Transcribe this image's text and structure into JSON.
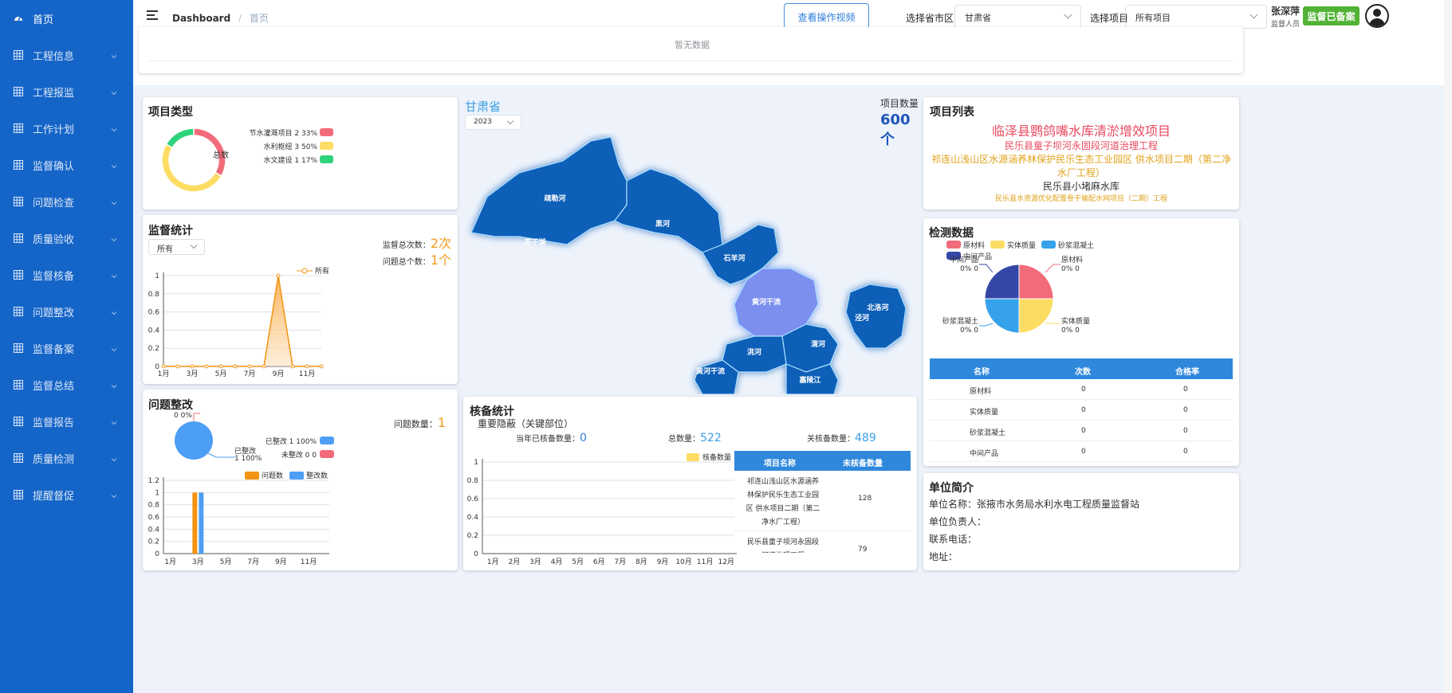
{
  "sidebar": {
    "items": [
      {
        "label": "首页",
        "icon": "dashboard-icon",
        "active": true
      },
      {
        "label": "工程信息",
        "icon": "grid-icon"
      },
      {
        "label": "工程报监",
        "icon": "grid-icon"
      },
      {
        "label": "工作计划",
        "icon": "grid-icon"
      },
      {
        "label": "监督确认",
        "icon": "grid-icon"
      },
      {
        "label": "问题检查",
        "icon": "grid-icon"
      },
      {
        "label": "质量验收",
        "icon": "grid-icon"
      },
      {
        "label": "监督核备",
        "icon": "grid-icon"
      },
      {
        "label": "问题整改",
        "icon": "grid-icon"
      },
      {
        "label": "监督备案",
        "icon": "grid-icon"
      },
      {
        "label": "监督总结",
        "icon": "grid-icon"
      },
      {
        "label": "监督报告",
        "icon": "grid-icon"
      },
      {
        "label": "质量检测",
        "icon": "grid-icon"
      },
      {
        "label": "提醒督促",
        "icon": "grid-icon"
      }
    ]
  },
  "header": {
    "breadcrumb_root": "Dashboard",
    "breadcrumb_sep": "/",
    "breadcrumb_current": "首页",
    "video_button": "查看操作视频",
    "city_label": "选择省市区",
    "city_value": "甘肃省",
    "project_label": "选择项目",
    "project_value": "所有项目",
    "user_name": "张深萍",
    "user_role": "监督人员",
    "status_button": "监督已备案"
  },
  "notice": {
    "empty_text": "暂无数据"
  },
  "project_type": {
    "title": "项目类型",
    "center_label": "总数",
    "legend": [
      {
        "name": "节水灌溉项目",
        "count": "2",
        "percent": "33%",
        "color": "#f26b7a",
        "value": 2
      },
      {
        "name": "水利枢纽",
        "count": "3",
        "percent": "50%",
        "color": "#fcdc62",
        "value": 3
      },
      {
        "name": "水文建设",
        "count": "1",
        "percent": "17%",
        "color": "#2fd37c",
        "value": 1
      }
    ]
  },
  "supervision": {
    "title": "监督统计",
    "filter_value": "所有",
    "total_label": "监督总次数：",
    "total_value": "2次",
    "problem_label": "问题总个数：",
    "problem_value": "1个",
    "legend": "所有"
  },
  "rectification": {
    "title": "问题整改",
    "count_label": "问题数量：",
    "count_value": "1",
    "pie_labels": {
      "top": "0  0%",
      "right_name": "已整改",
      "right_value": "1  100%"
    },
    "legend": [
      {
        "name": "已整改",
        "count": "1",
        "percent": "100%",
        "color": "#4d9ef5"
      },
      {
        "name": "未整改",
        "count": "0",
        "percent": "0",
        "color": "#f26b7a"
      }
    ],
    "bar_legend": [
      {
        "name": "问题数",
        "color": "#f39313"
      },
      {
        "name": "整改数",
        "color": "#4d9ef5"
      }
    ]
  },
  "map": {
    "province": "甘肃省",
    "year": "2023",
    "count_label": "项目数量",
    "count_value": "600个",
    "regions": [
      "疏勒河",
      "苏干湖",
      "黑河",
      "石羊河",
      "黄河干流",
      "北洛河",
      "泾河",
      "渭河",
      "洮河",
      "黄河干流",
      "嘉陵江"
    ]
  },
  "projects": {
    "title": "项目列表",
    "items": [
      {
        "text": "临泽县鹦鸽嘴水库清淤增效项目",
        "color": "#e84a5f",
        "size": 16
      },
      {
        "text": "民乐县童子坝河永固段河道治理工程",
        "color": "#e84a5f",
        "size": 12
      },
      {
        "text": "祁连山浅山区水源涵养林保护民乐生态工业园区 供水项目二期（第二净水厂工程）",
        "color": "#e0a21a",
        "size": 12
      },
      {
        "text": "民乐县小堵麻水库",
        "color": "#333333",
        "size": 12
      },
      {
        "text": "民乐县水资源优化配置骨干输配水网项目（二期）工程",
        "color": "#e0a21a",
        "size": 9
      }
    ]
  },
  "testing": {
    "title": "检测数据",
    "legend": [
      {
        "name": "原材料",
        "color": "#f26b7a"
      },
      {
        "name": "实体质量",
        "color": "#fcdc62"
      },
      {
        "name": "砂浆混凝土",
        "color": "#36a2eb"
      },
      {
        "name": "中间产品",
        "color": "#3447a6"
      }
    ],
    "pie_labels": [
      {
        "name": "原材料",
        "value": "0%  0"
      },
      {
        "name": "实体质量",
        "value": "0%  0"
      },
      {
        "name": "砂浆混凝土",
        "value": "0%  0"
      },
      {
        "name": "中间产品",
        "value": "0%  0"
      }
    ],
    "table_headers": [
      "名称",
      "次数",
      "合格率"
    ],
    "rows": [
      [
        "原材料",
        "0",
        "0"
      ],
      [
        "实体质量",
        "0",
        "0"
      ],
      [
        "砂浆混凝土",
        "0",
        "0"
      ],
      [
        "中间产品",
        "0",
        "0"
      ]
    ]
  },
  "verify": {
    "title": "核备统计",
    "subtitle": "重要隐蔽（关键部位）",
    "month_label": "当年已核备数量：",
    "month_value": "0",
    "total_label": "总数量：",
    "total_value": "522",
    "closed_label": "关核备数量：",
    "closed_value": "489",
    "legend": "核备数量",
    "table_headers": [
      "项目名称",
      "未核备数量"
    ],
    "rows": [
      {
        "name": "祁连山浅山区水源涵养林保护民乐生态工业园区 供水项目二期（第二净水厂工程）",
        "count": "128"
      },
      {
        "name": "民乐县童子坝河永固段河道治理工程",
        "count": "79"
      }
    ]
  },
  "unit": {
    "title": "单位简介",
    "name_label": "单位名称：",
    "name_value": "张掖市水务局水利水电工程质量监督站",
    "leader_label": "单位负责人：",
    "phone_label": "联系电话：",
    "address_label": "地址："
  },
  "chart_data": [
    {
      "type": "pie",
      "title": "项目类型",
      "labels": [
        "节水灌溉项目",
        "水利枢纽",
        "水文建设"
      ],
      "values": [
        2,
        3,
        1
      ]
    },
    {
      "type": "line",
      "title": "监督统计",
      "categories": [
        "1月",
        "2月",
        "3月",
        "4月",
        "5月",
        "6月",
        "7月",
        "8月",
        "9月",
        "10月",
        "11月",
        "12月"
      ],
      "tick_labels": [
        "1月",
        "3月",
        "5月",
        "7月",
        "9月",
        "11月"
      ],
      "series": [
        {
          "name": "所有",
          "values": [
            0,
            0,
            0,
            0,
            0,
            0,
            0,
            0,
            1,
            0,
            0,
            0
          ]
        }
      ],
      "ylim": [
        0,
        1
      ],
      "yticks": [
        "0",
        "0.2",
        "0.4",
        "0.6",
        "0.8",
        "1"
      ]
    },
    {
      "type": "bar",
      "title": "问题整改",
      "categories": [
        "1月",
        "2月",
        "3月",
        "4月",
        "5月",
        "6月",
        "7月",
        "8月",
        "9月",
        "10月",
        "11月",
        "12月"
      ],
      "tick_labels": [
        "1月",
        "3月",
        "5月",
        "7月",
        "9月",
        "11月"
      ],
      "series": [
        {
          "name": "问题数",
          "values": [
            0,
            0,
            1,
            0,
            0,
            0,
            0,
            0,
            0,
            0,
            0,
            0
          ]
        },
        {
          "name": "整改数",
          "values": [
            0,
            0,
            1,
            0,
            0,
            0,
            0,
            0,
            0,
            0,
            0,
            0
          ]
        }
      ],
      "ylim": [
        0,
        1.2
      ],
      "yticks": [
        "0",
        "0.2",
        "0.4",
        "0.6",
        "0.8",
        "1",
        "1.2"
      ]
    },
    {
      "type": "bar",
      "title": "核备统计",
      "categories": [
        "1月",
        "2月",
        "3月",
        "4月",
        "5月",
        "6月",
        "7月",
        "8月",
        "9月",
        "10月",
        "11月",
        "12月"
      ],
      "series": [
        {
          "name": "核备数量",
          "values": [
            0,
            0,
            0,
            0,
            0,
            0,
            0,
            0,
            0,
            0,
            0,
            0
          ]
        }
      ],
      "ylim": [
        0,
        1
      ],
      "yticks": [
        "0",
        "0.2",
        "0.4",
        "0.6",
        "0.8",
        "1"
      ]
    },
    {
      "type": "pie",
      "title": "检测数据",
      "labels": [
        "原材料",
        "实体质量",
        "砂浆混凝土",
        "中间产品"
      ],
      "values": [
        0,
        0,
        0,
        0
      ]
    }
  ]
}
